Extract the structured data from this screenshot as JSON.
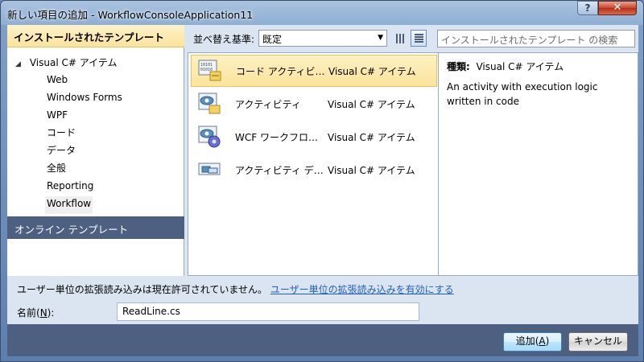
{
  "window": {
    "title": "新しい項目の追加 - WorkflowConsoleApplication11",
    "help_label": "?",
    "close_label": "✕"
  },
  "left_panel": {
    "installed_header": "インストールされたテンプレート",
    "tree_root": "Visual C# アイテム",
    "tree_items": [
      "Web",
      "Windows Forms",
      "WPF",
      "コード",
      "データ",
      "全般",
      "Reporting",
      "Workflow"
    ],
    "selected_item": "Workflow",
    "online_header": "オンライン テンプレート"
  },
  "toolbar": {
    "sort_label": "並べ替え基準:",
    "sort_value": "既定",
    "search_placeholder": "インストールされたテンプレート の検索"
  },
  "templates": [
    {
      "name": "コード アクティビティ",
      "type": "Visual C# アイテム",
      "icon": "code-activity-icon"
    },
    {
      "name": "アクティビティ",
      "type": "Visual C# アイテム",
      "icon": "activity-icon"
    },
    {
      "name": "WCF ワークフロー サービス",
      "type": "Visual C# アイテム",
      "icon": "wcf-workflow-icon"
    },
    {
      "name": "アクティビティ デザイナー",
      "type": "Visual C# アイテム",
      "icon": "activity-designer-icon"
    }
  ],
  "details": {
    "kind_label": "種類:",
    "kind_value": "Visual C# アイテム",
    "description": "An activity with execution logic written in code"
  },
  "bottom": {
    "notice_text": "ユーザー単位の拡張読み込みは現在許可されていません。",
    "notice_link": "ユーザー単位の拡張読み込みを有効にする",
    "name_label_prefix": "名前(",
    "name_label_key": "N",
    "name_label_suffix": "):",
    "name_value": "ReadLine.cs"
  },
  "buttons": {
    "add_prefix": "追加(",
    "add_key": "A",
    "add_suffix": ")",
    "cancel": "キャンセル"
  },
  "colors": {
    "selection_fill": "#fbe39b",
    "header_dark": "#4d6082",
    "link": "#1f5fbf"
  }
}
